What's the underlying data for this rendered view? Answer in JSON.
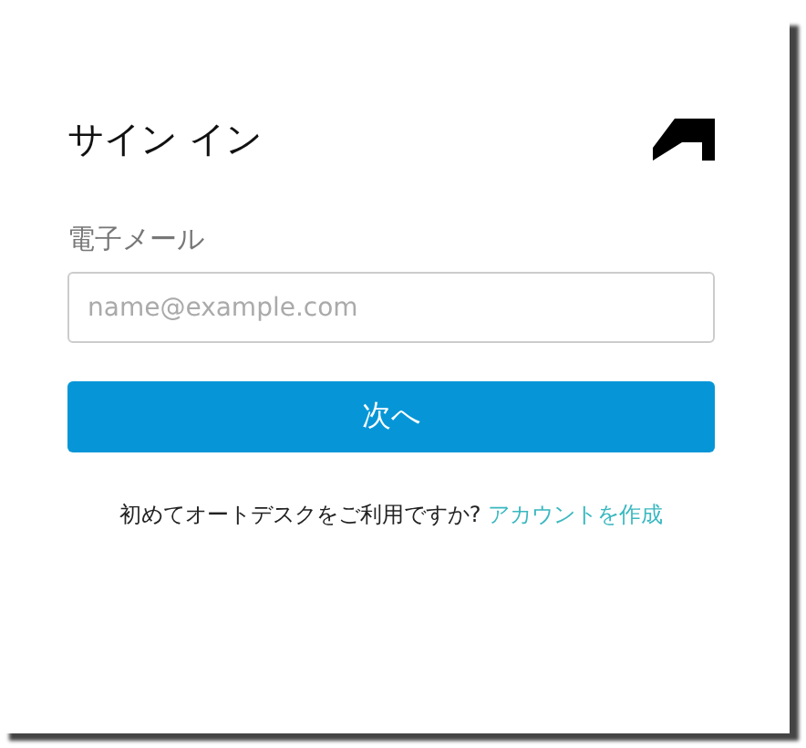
{
  "title": "サイン イン",
  "email": {
    "label": "電子メール",
    "placeholder": "name@example.com"
  },
  "next_button": "次へ",
  "footer": {
    "text": "初めてオートデスクをご利用ですか?",
    "link": "アカウントを作成"
  }
}
